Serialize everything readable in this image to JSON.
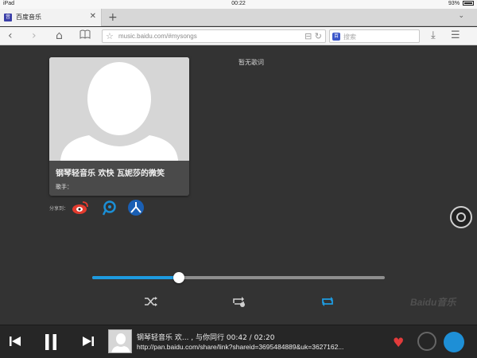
{
  "statusbar": {
    "device": "iPad",
    "time": "00:22",
    "battery": "93%"
  },
  "tab": {
    "title": "百度音乐",
    "favicon": "音"
  },
  "address": {
    "url": "music.baidu.com/#mysongs",
    "search_placeholder": "搜索",
    "search_badge": "百"
  },
  "song": {
    "title": "钢琴轻音乐 欢快 瓦妮莎的微笑",
    "singer_label": "歌手："
  },
  "share": {
    "label": "分享到："
  },
  "lyrics": {
    "empty": "暂无歌词"
  },
  "playback": {
    "progress": 0.295
  },
  "watermark": "Baidu音乐",
  "now_playing": {
    "title": "钢琴轻音乐 欢...        , 与你同行 00:42 / 02:20",
    "link": "http://pan.baidu.com/share/link?shareid=3695484889&uk=3627162..."
  },
  "colors": {
    "accent": "#1e9be0",
    "heart": "#e23b3b"
  }
}
